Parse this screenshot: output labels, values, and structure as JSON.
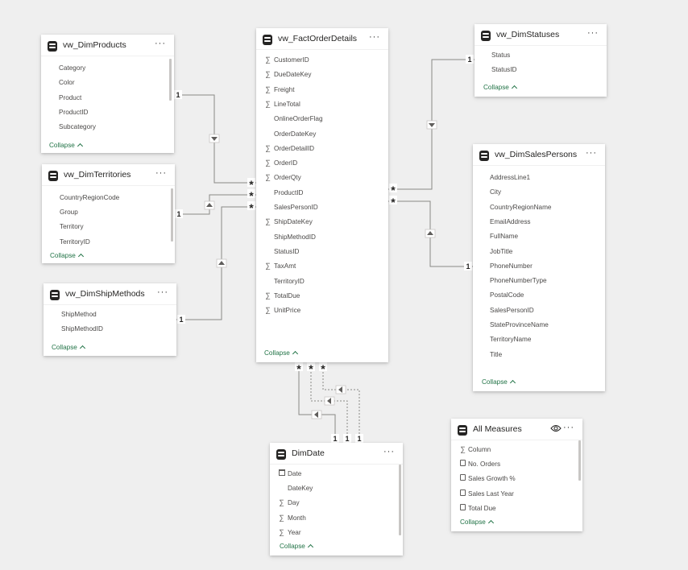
{
  "tables": {
    "products": {
      "title": "vw_DimProducts",
      "fields": [
        "Category",
        "Color",
        "Product",
        "ProductID",
        "Subcategory"
      ],
      "collapse": "Collapse"
    },
    "territories": {
      "title": "vw_DimTerritories",
      "fields": [
        "CountryRegionCode",
        "Group",
        "Territory",
        "TerritoryID"
      ],
      "collapse": "Collapse"
    },
    "shipmethods": {
      "title": "vw_DimShipMethods",
      "fields": [
        "ShipMethod",
        "ShipMethodID"
      ],
      "collapse": "Collapse"
    },
    "fact": {
      "title": "vw_FactOrderDetails",
      "fields": [
        {
          "label": "CustomerID",
          "sigma": true
        },
        {
          "label": "DueDateKey",
          "sigma": true
        },
        {
          "label": "Freight",
          "sigma": true
        },
        {
          "label": "LineTotal",
          "sigma": true
        },
        {
          "label": "OnlineOrderFlag",
          "sigma": false
        },
        {
          "label": "OrderDateKey",
          "sigma": false
        },
        {
          "label": "OrderDetailID",
          "sigma": true
        },
        {
          "label": "OrderID",
          "sigma": true
        },
        {
          "label": "OrderQty",
          "sigma": true
        },
        {
          "label": "ProductID",
          "sigma": false
        },
        {
          "label": "SalesPersonID",
          "sigma": false
        },
        {
          "label": "ShipDateKey",
          "sigma": true
        },
        {
          "label": "ShipMethodID",
          "sigma": false
        },
        {
          "label": "StatusID",
          "sigma": false
        },
        {
          "label": "TaxAmt",
          "sigma": true
        },
        {
          "label": "TerritoryID",
          "sigma": false
        },
        {
          "label": "TotalDue",
          "sigma": true
        },
        {
          "label": "UnitPrice",
          "sigma": true
        }
      ],
      "collapse": "Collapse"
    },
    "statuses": {
      "title": "vw_DimStatuses",
      "fields": [
        "Status",
        "StatusID"
      ],
      "collapse": "Collapse"
    },
    "salespersons": {
      "title": "vw_DimSalesPersons",
      "fields": [
        "AddressLine1",
        "City",
        "CountryRegionName",
        "EmailAddress",
        "FullName",
        "JobTitle",
        "PhoneNumber",
        "PhoneNumberType",
        "PostalCode",
        "SalesPersonID",
        "StateProvinceName",
        "TerritoryName",
        "Title"
      ],
      "collapse": "Collapse"
    },
    "dimdate": {
      "title": "DimDate",
      "fields": [
        {
          "label": "Date",
          "glyph": "calendar"
        },
        {
          "label": "DateKey",
          "glyph": "none"
        },
        {
          "label": "Day",
          "glyph": "sigma"
        },
        {
          "label": "Month",
          "glyph": "sigma"
        },
        {
          "label": "Year",
          "glyph": "sigma"
        }
      ],
      "collapse": "Collapse"
    },
    "measures": {
      "title": "All Measures",
      "fields": [
        {
          "label": "Column",
          "glyph": "sigma"
        },
        {
          "label": "No. Orders",
          "glyph": "calc"
        },
        {
          "label": "Sales Growth %",
          "glyph": "calc"
        },
        {
          "label": "Sales Last Year",
          "glyph": "calc"
        },
        {
          "label": "Total Due",
          "glyph": "calc"
        }
      ],
      "collapse": "Collapse"
    }
  },
  "relationships": {
    "one": "1",
    "many": "*"
  },
  "icons": {
    "table": "table-icon",
    "more": "more-options-icon",
    "eye": "eye-icon",
    "sigma": "sigma-icon",
    "calc": "calculator-icon",
    "calendar": "calendar-icon",
    "filter_arrow": "filter-direction-arrow-icon"
  },
  "colors": {
    "canvas": "#efefef",
    "card": "#ffffff",
    "collapse_link": "#217346",
    "line": "#8a8886"
  },
  "more_glyph": "···",
  "sigma_glyph": "∑"
}
